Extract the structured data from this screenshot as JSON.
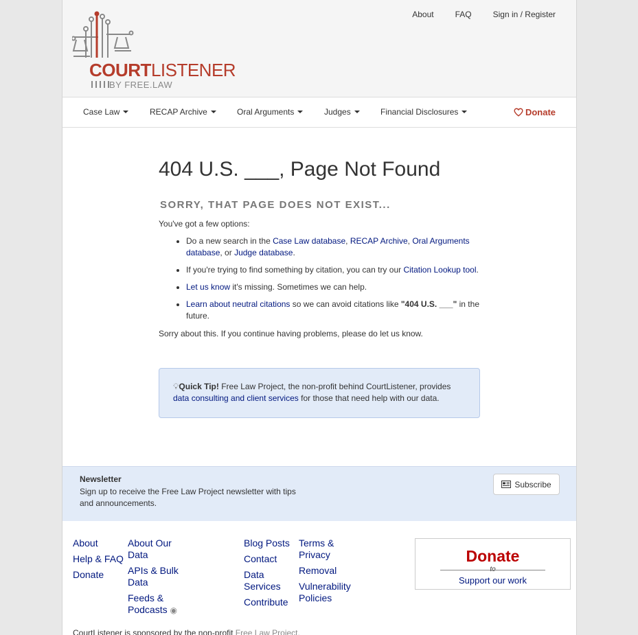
{
  "brand": {
    "name_court": "COURT",
    "name_listener": "LISTENER",
    "byline": "BY FREE.LAW"
  },
  "toplinks": [
    "About",
    "FAQ",
    "Sign in / Register"
  ],
  "nav": {
    "items": [
      "Case Law",
      "RECAP Archive",
      "Oral Arguments",
      "Judges",
      "Financial Disclosures"
    ],
    "donate": "Donate"
  },
  "main": {
    "title": "404 U.S. ___, Page Not Found",
    "subtitle": "Sorry, that page does not exist...",
    "intro": "You've got a few options:",
    "opt1_prefix": "Do a new search in the ",
    "opt1_link1": "Case Law database",
    "opt1_sep1": ", ",
    "opt1_link2": "RECAP Archive",
    "opt1_sep2": ", ",
    "opt1_link3": "Oral Arguments database",
    "opt1_sep3": ", or ",
    "opt1_link4": "Judge database",
    "opt1_end": ".",
    "opt2_prefix": "If you're trying to find something by citation, you can try our ",
    "opt2_link": "Citation Lookup tool",
    "opt2_end": ".",
    "opt3_link": "Let us know",
    "opt3_rest": " it's missing. Sometimes we can help.",
    "opt4_link": "Learn about neutral citations",
    "opt4_mid": " so we can avoid citations like ",
    "opt4_bold": "\"404 U.S. ___\"",
    "opt4_end": " in the future.",
    "closing": "Sorry about this. If you continue having problems, please do let us know."
  },
  "tip": {
    "label": "Quick Tip!",
    "text": " Free Law Project, the non-profit behind CourtListener, provides ",
    "link": "data consulting and client services",
    "end": " for those that need help with our data."
  },
  "newsletter": {
    "title": "Newsletter",
    "desc": "Sign up to receive the Free Law Project newsletter with tips and announcements.",
    "button": "Subscribe"
  },
  "footer": {
    "col1": [
      "About",
      "Help & FAQ",
      "Donate"
    ],
    "col2": [
      "About Our Data",
      "APIs & Bulk Data",
      "Feeds & Podcasts"
    ],
    "col3": [
      "Blog Posts",
      "Contact",
      "Data Services",
      "Contribute"
    ],
    "col4": [
      "Terms & Privacy",
      "Removal",
      "Vulnerability Policies"
    ],
    "donate_big": "Donate",
    "donate_to": "to",
    "donate_support": "Support our work",
    "sponsor_text": "CourtListener is sponsored by the non-profit ",
    "sponsor_link": "Free Law Project."
  },
  "colors": {
    "brand_red": "#b53c2b",
    "link": "#00177f",
    "tip_bg": "#e2ebf8"
  }
}
